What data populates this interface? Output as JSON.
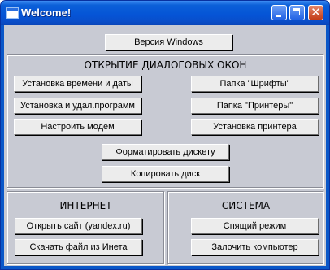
{
  "window": {
    "title": "Welcome!",
    "icon": "app-window-icon"
  },
  "titlebar": {
    "minimize": "minimize-icon",
    "maximize": "maximize-icon",
    "close": "close-icon"
  },
  "top": {
    "version_button": "Версия Windows"
  },
  "dialogs": {
    "label": "ОТКРЫТИЕ ДИАЛОГОВЫХ ОКОН",
    "buttons": {
      "datetime": "Установка времени и даты",
      "addremove": "Установка и удал.программ",
      "modem": "Настроить модем",
      "fonts": "Папка \"Шрифты\"",
      "printers": "Папка \"Принтеры\"",
      "printer_setup": "Установка принтера",
      "format_floppy": "Форматировать дискету",
      "copy_disk": "Копировать диск"
    }
  },
  "internet": {
    "label": "ИНТЕРНЕТ",
    "open_site": "Открыть сайт (yandex.ru)",
    "download": "Скачать файл из Инета"
  },
  "system": {
    "label": "СИСТЕМА",
    "sleep": "Спящий режим",
    "lock": "Залочить компьютер"
  }
}
